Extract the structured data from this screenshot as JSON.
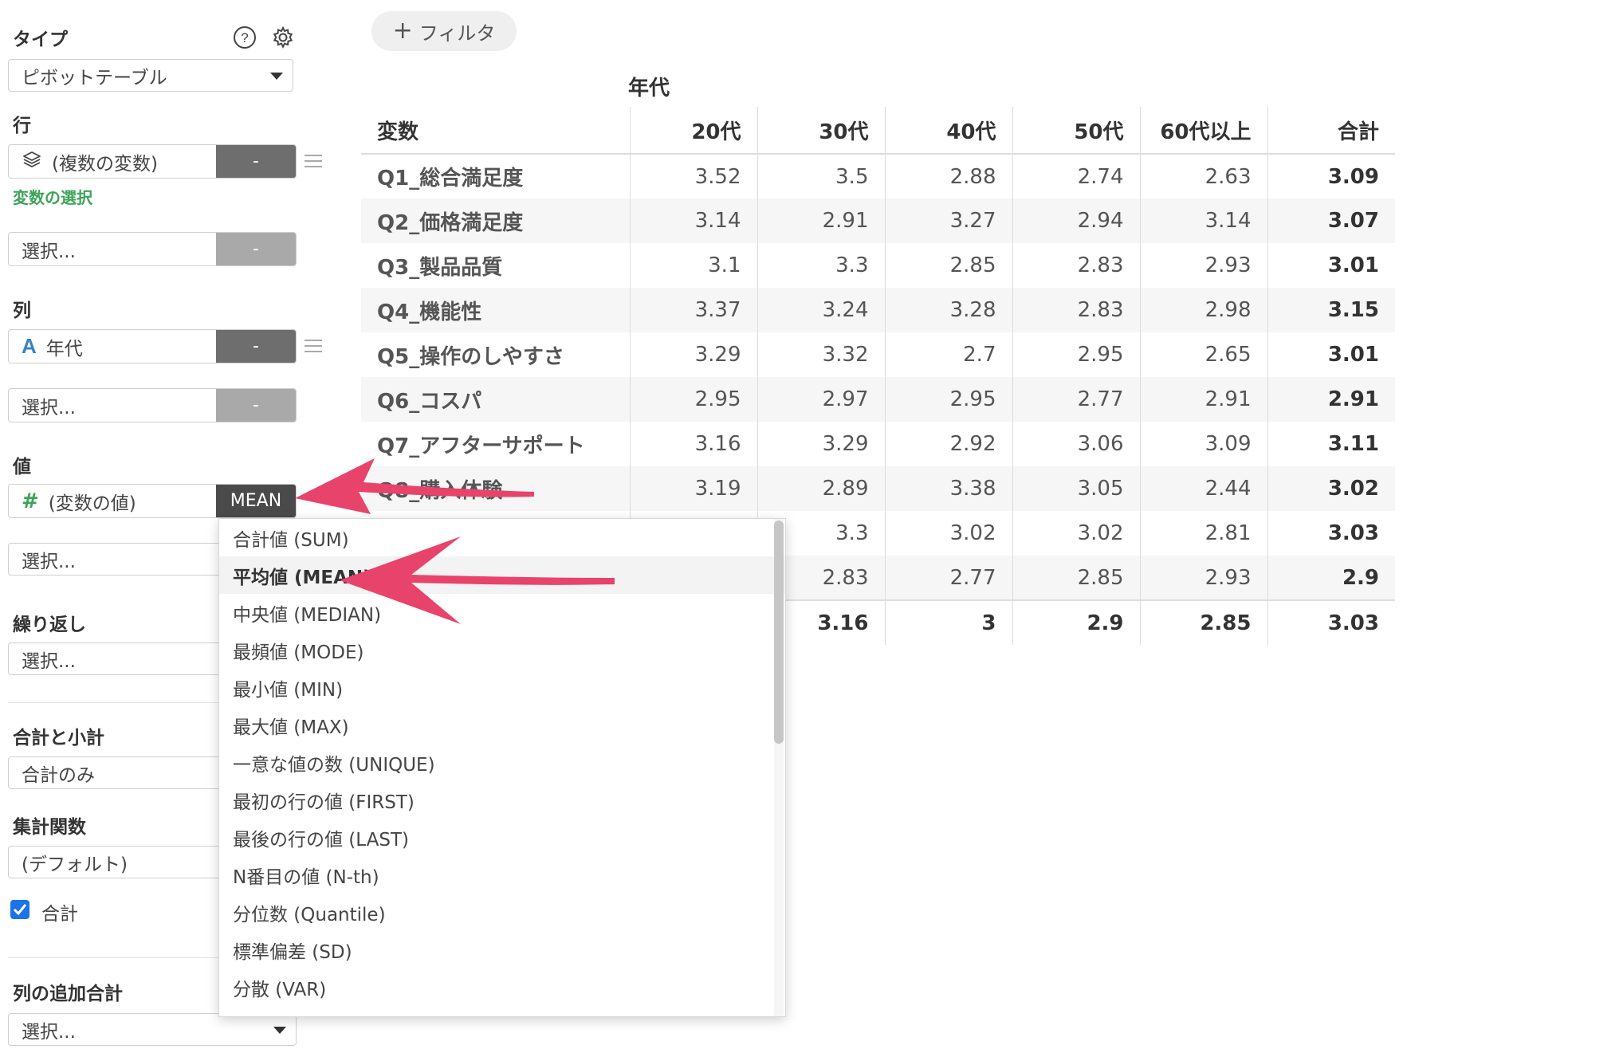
{
  "sidebar": {
    "type_label": "タイプ",
    "type_value": "ピボットテーブル",
    "row_label": "行",
    "row_field": "(複数の変数)",
    "row_btn": "-",
    "variable_select_link": "変数の選択",
    "select_placeholder": "選択...",
    "select_btn": "-",
    "col_label": "列",
    "col_field": "年代",
    "col_btn": "-",
    "value_label": "値",
    "value_field": "(変数の値)",
    "value_agg": "MEAN",
    "repeat_label": "繰り返し",
    "totals_label": "合計と小計",
    "totals_value": "合計のみ",
    "aggfunc_label": "集計関数",
    "aggfunc_value": "(デフォルト)",
    "total_checkbox_label": "合計",
    "total_checked": true,
    "extra_total_label": "列の追加合計"
  },
  "toolbar": {
    "filter_label": "フィルタ",
    "filter_icon": "plus-icon"
  },
  "table": {
    "column_group": "年代",
    "headers": [
      "変数",
      "20代",
      "30代",
      "40代",
      "50代",
      "60代以上",
      "合計"
    ],
    "rows": [
      [
        "Q1_総合満足度",
        "3.52",
        "3.5",
        "2.88",
        "2.74",
        "2.63",
        "3.09"
      ],
      [
        "Q2_価格満足度",
        "3.14",
        "2.91",
        "3.27",
        "2.94",
        "3.14",
        "3.07"
      ],
      [
        "Q3_製品品質",
        "3.1",
        "3.3",
        "2.85",
        "2.83",
        "2.93",
        "3.01"
      ],
      [
        "Q4_機能性",
        "3.37",
        "3.24",
        "3.28",
        "2.83",
        "2.98",
        "3.15"
      ],
      [
        "Q5_操作のしやすさ",
        "3.29",
        "3.32",
        "2.7",
        "2.95",
        "2.65",
        "3.01"
      ],
      [
        "Q6_コスパ",
        "2.95",
        "2.97",
        "2.95",
        "2.77",
        "2.91",
        "2.91"
      ],
      [
        "Q7_アフターサポート",
        "3.16",
        "3.29",
        "2.92",
        "3.06",
        "3.09",
        "3.11"
      ],
      [
        "Q8_購入体験",
        "3.19",
        "2.89",
        "3.38",
        "3.05",
        "2.44",
        "3.02"
      ],
      [
        "",
        "",
        "3.3",
        "3.02",
        "3.02",
        "2.81",
        "3.03"
      ],
      [
        "",
        "",
        "2.83",
        "2.77",
        "2.85",
        "2.93",
        "2.9"
      ]
    ],
    "grand_total": [
      "",
      "",
      "3.16",
      "3",
      "2.9",
      "2.85",
      "3.03"
    ]
  },
  "dropdown": {
    "items": [
      "合計値 (SUM)",
      "平均値 (MEAN)",
      "中央値 (MEDIAN)",
      "最頻値 (MODE)",
      "最小値 (MIN)",
      "最大値 (MAX)",
      "一意な値の数 (UNIQUE)",
      "最初の行の値 (FIRST)",
      "最後の行の値 (LAST)",
      "N番目の値 (N-th)",
      "分位数 (Quantile)",
      "標準偏差 (SD)",
      "分散 (VAR)"
    ],
    "selected_index": 1
  },
  "colors": {
    "accent_green": "#3ea35a",
    "arrow_pink": "#e8436a",
    "checkbox_blue": "#1a73e8",
    "type_icon_blue": "#3b82c4",
    "hash_icon_green": "#3ea35a"
  }
}
